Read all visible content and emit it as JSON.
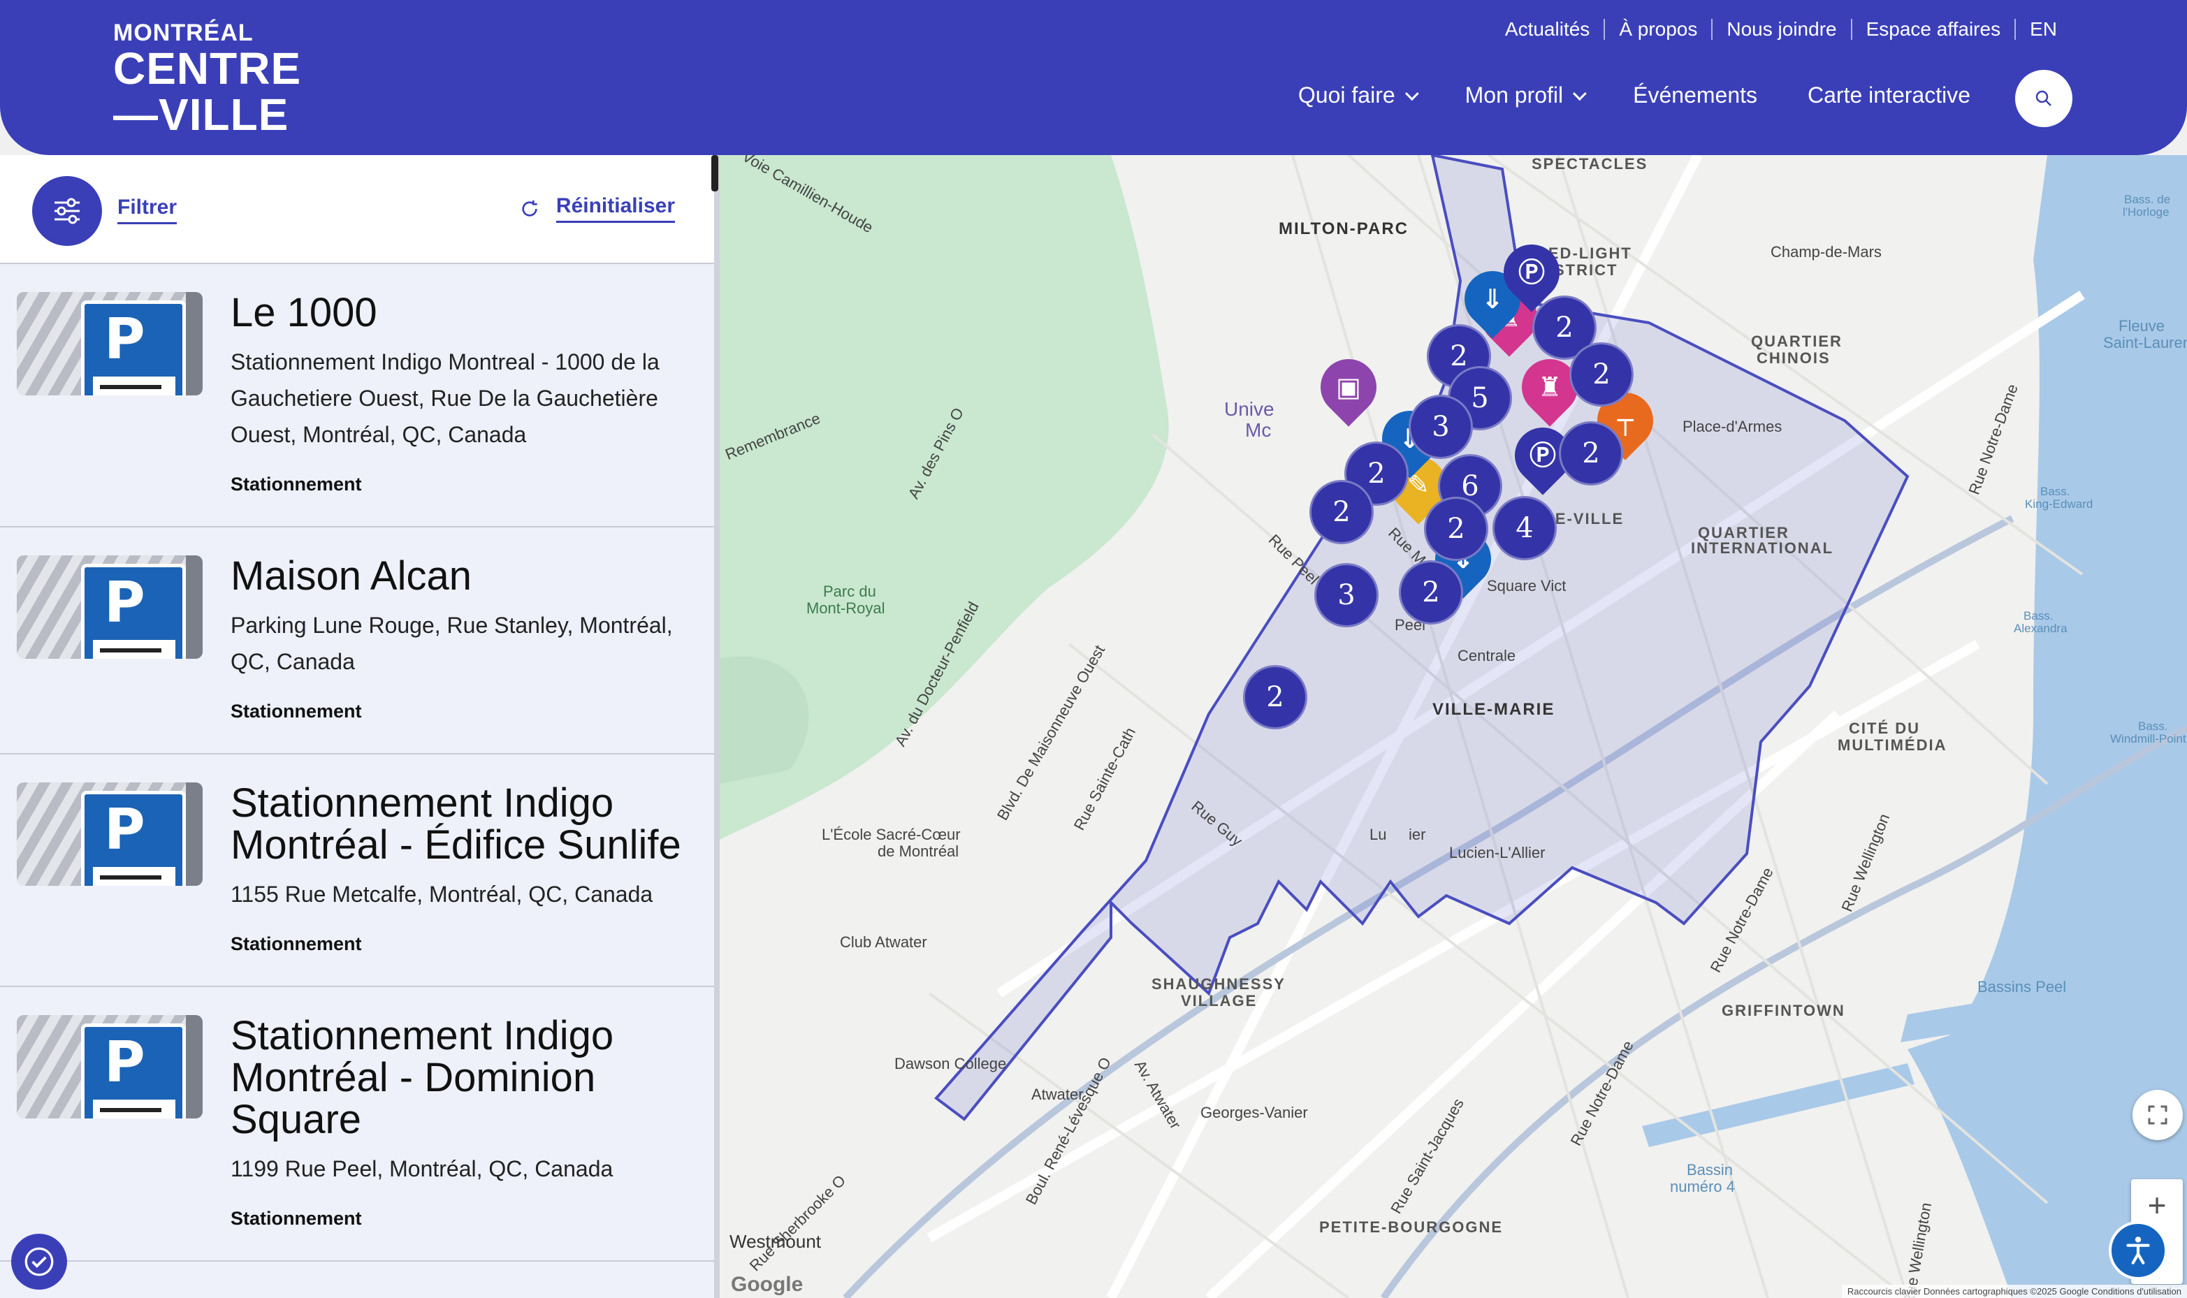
{
  "header": {
    "logo": {
      "line1": "MONTRÉAL",
      "line2": "CENTRE",
      "line3": "—VILLE"
    },
    "top_links": [
      "Actualités",
      "À propos",
      "Nous joindre",
      "Espace affaires",
      "EN"
    ],
    "nav": [
      {
        "label": "Quoi faire",
        "has_dropdown": true
      },
      {
        "label": "Mon profil",
        "has_dropdown": true
      },
      {
        "label": "Événements",
        "has_dropdown": false
      },
      {
        "label": "Carte interactive",
        "has_dropdown": false
      }
    ],
    "search_icon": "search-icon"
  },
  "sidebar": {
    "filter_label": "Filtrer",
    "reset_label": "Réinitialiser",
    "items": [
      {
        "title": "Le 1000",
        "address": "Stationnement Indigo Montreal - 1000 de la Gauchetiere Ouest, Rue De la Gauchetière Ouest, Montréal, QC, Canada",
        "category": "Stationnement"
      },
      {
        "title": "Maison Alcan",
        "address": "Parking Lune Rouge, Rue Stanley, Montréal, QC, Canada",
        "category": "Stationnement"
      },
      {
        "title": "Stationnement Indigo Montréal - Édifice Sunlife",
        "address": "1155 Rue Metcalfe, Montréal, QC, Canada",
        "category": "Stationnement"
      },
      {
        "title": "Stationnement Indigo Montréal - Dominion Square",
        "address": "1199 Rue Peel, Montréal, QC, Canada",
        "category": "Stationnement"
      }
    ]
  },
  "map": {
    "clusters": [
      "2",
      "2",
      "2",
      "5",
      "3",
      "2",
      "6",
      "2",
      "2",
      "4",
      "2",
      "3",
      "2",
      "2"
    ],
    "labels": {
      "milton_parc": "MILTON-PARC",
      "spectacles": "SPECTACLES",
      "red_light": "RED-LIGHT",
      "district": "DISTRICT",
      "champ_de_mars": "Champ-de-Mars",
      "quartier_chinois_1": "QUARTIER",
      "quartier_chinois_2": "CHINOIS",
      "place_d_armes": "Place-d'Armes",
      "centre_ville": "CENTRE-VILLE",
      "quartier_intl_1": "QUARTIER",
      "quartier_intl_2": "INTERNATIONAL",
      "ville_marie": "VILLE-MARIE",
      "peel": "Peel",
      "centrale": "Centrale",
      "cite_du_1": "CITÉ DU",
      "cite_du_2": "MULTIMÉDIA",
      "shaughnessy_1": "SHAUGHNESSY",
      "shaughnessy_2": "VILLAGE",
      "lucien": "Lucien-L'Allier",
      "griffintown": "GRIFFINTOWN",
      "petite_bourgogne": "PETITE-BOURGOGNE",
      "westmount": "Westmount",
      "atwater": "Atwater",
      "georges_vanier": "Georges-Vanier",
      "parc_mont_royal_1": "Parc du",
      "parc_mont_royal_2": "Mont-Royal",
      "ecole_sacre_coeur_1": "L'École Sacré-Cœur",
      "ecole_sacre_coeur_2": "de Montréal",
      "club_atwater": "Club Atwater",
      "dawson": "Dawson College",
      "bassins_peel": "Bassins Peel",
      "bassin_4_1": "Bassin",
      "bassin_4_2": "numéro 4",
      "fleuve_1": "Fleuve",
      "fleuve_2": "Saint-Laurent",
      "bass_alexandra_1": "Bass.",
      "bass_alexandra_2": "Alexandra",
      "bass_king_1": "Bass.",
      "bass_king_2": "King-Edward",
      "bass_horloge_1": "Bass. de",
      "bass_horloge_2": "l'Horloge",
      "bass_windmill_1": "Bass.",
      "bass_windmill_2": "Windmill-Point",
      "univ_1": "Unive",
      "univ_2": "Mc",
      "square_vict": "Square Vict",
      "rue_peel": "Rue Peel",
      "rue_guy": "Rue Guy",
      "rue_saint_jacques": "Rue Saint-Jacques",
      "rue_notre_dame": "Rue Notre-Dame",
      "av_atwater": "Av. Atwater",
      "av_des_pins": "Av. des Pins O",
      "voie_camillien": "Voie Camillien-Houde",
      "remembrance": "Remembrance",
      "blvd_maisonneuve": "Blvd. De Maisonneuve Ouest",
      "rue_sainte_cath": "Rue Sainte-Cath",
      "rue_mansfield": "Rue Mansfield",
      "boul_rene_levesque": "Boul. René-Lévesque O",
      "rue_wellington": "Rue Wellington",
      "av_docteur_penfield": "Av. du Docteur-Penfield",
      "rue_sherbrooke": "Rue Sherbrooke O",
      "lucien_short": "Lu",
      "lucien_mid": "ier"
    },
    "attribution": "Raccourcis clavier   Données cartographiques ©2025 Google   Conditions d'utilisation",
    "google": "Google",
    "zoom_in": "+",
    "accent": "#3a3fb8",
    "cluster_color": "#3434a8"
  }
}
